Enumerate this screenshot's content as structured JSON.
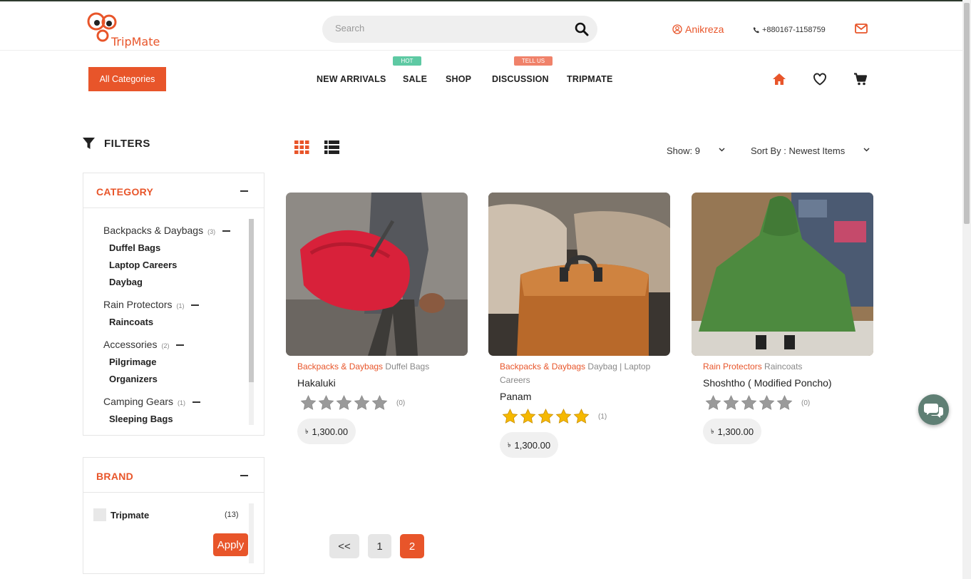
{
  "header": {
    "logo_text": "TripMate",
    "search_placeholder": "Search",
    "user_name": "Anikreza",
    "phone": "+880167-1158759"
  },
  "nav": {
    "all_categories": "All Categories",
    "items": [
      {
        "label": "NEW ARRIVALS"
      },
      {
        "label": "SALE",
        "tag": "HOT"
      },
      {
        "label": "SHOP"
      },
      {
        "label": "DISCUSSION",
        "tag": "TELL US"
      },
      {
        "label": "TRIPMATE"
      }
    ]
  },
  "filters": {
    "title": "FILTERS",
    "category": {
      "heading": "CATEGORY",
      "groups": [
        {
          "label": "Backpacks & Daybags",
          "count": "(3)",
          "subs": [
            "Duffel Bags",
            "Laptop Careers",
            "Daybag"
          ]
        },
        {
          "label": "Rain Protectors",
          "count": "(1)",
          "subs": [
            "Raincoats"
          ]
        },
        {
          "label": "Accessories",
          "count": "(2)",
          "subs": [
            "Pilgrimage",
            "Organizers"
          ]
        },
        {
          "label": "Camping Gears",
          "count": "(1)",
          "subs": [
            "Sleeping Bags"
          ]
        }
      ]
    },
    "brand": {
      "heading": "BRAND",
      "items": [
        {
          "label": "Tripmate",
          "count": "(13)"
        }
      ],
      "apply": "Apply"
    }
  },
  "toolbar": {
    "show": "Show: 9",
    "sort": "Sort By : Newest Items"
  },
  "products": [
    {
      "category": "Backpacks & Daybags",
      "sub": "Duffel Bags",
      "name": "Hakaluki",
      "rating": 0,
      "reviews": "(0)",
      "currency": "৳",
      "price": "1,300.00"
    },
    {
      "category": "Backpacks & Daybags",
      "sub": "Daybag | Laptop Careers",
      "name": "Panam",
      "rating": 5,
      "reviews": "(1)",
      "currency": "৳",
      "price": "1,300.00"
    },
    {
      "category": "Rain Protectors",
      "sub": "Raincoats",
      "name": "Shoshtho ( Modified Poncho)",
      "rating": 0,
      "reviews": "(0)",
      "currency": "৳",
      "price": "1,300.00"
    }
  ],
  "pagination": {
    "prev": "<<",
    "pages": [
      "1",
      "2"
    ],
    "current": "2"
  },
  "colors": {
    "accent": "#e8552a",
    "star_filled": "#f5b800",
    "star_empty": "#9a9a9a",
    "chat": "#5f7f74"
  }
}
